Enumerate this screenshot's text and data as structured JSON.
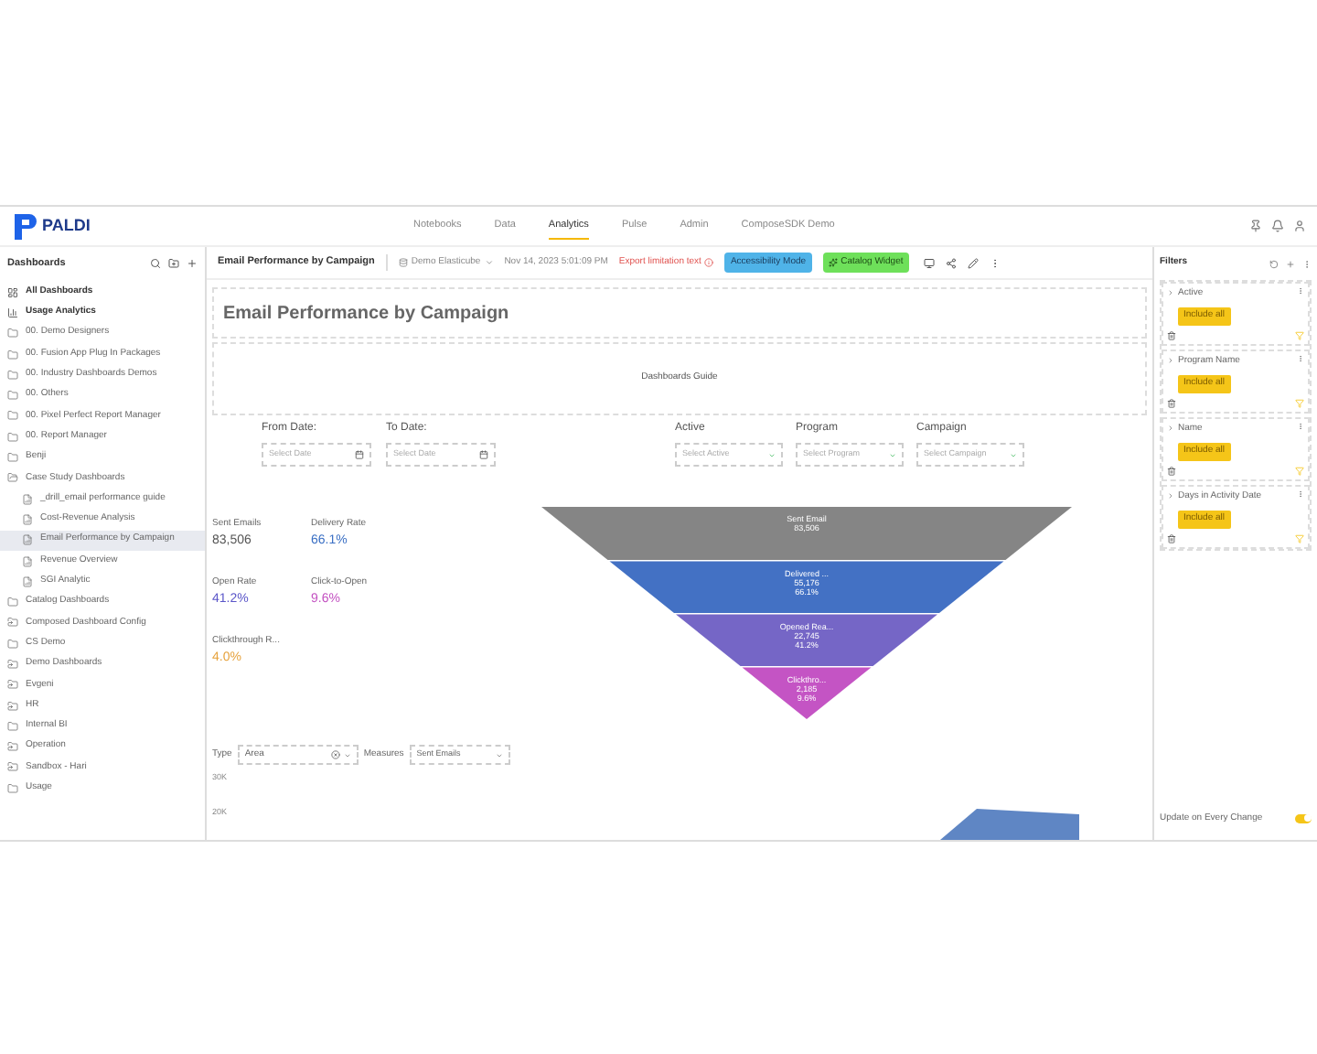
{
  "brand": "PALDI",
  "nav": [
    {
      "label": "Notebooks",
      "selected": false
    },
    {
      "label": "Data",
      "selected": false
    },
    {
      "label": "Analytics",
      "selected": true
    },
    {
      "label": "Pulse",
      "selected": false
    },
    {
      "label": "Admin",
      "selected": false
    },
    {
      "label": "ComposeSDK Demo",
      "selected": false
    }
  ],
  "sidebar": {
    "title": "Dashboards",
    "items": [
      {
        "kind": "all",
        "label": "All Dashboards",
        "selected": false
      },
      {
        "kind": "analytics",
        "label": "Usage Analytics",
        "selected": false
      },
      {
        "kind": "folder",
        "label": "00. Demo Designers",
        "selected": false
      },
      {
        "kind": "folder",
        "label": "00. Fusion App Plug In Packages",
        "selected": false
      },
      {
        "kind": "folder",
        "label": "00. Industry Dashboards Demos",
        "selected": false
      },
      {
        "kind": "folder",
        "label": "00. Others",
        "selected": false
      },
      {
        "kind": "folder",
        "label": "00. Pixel Perfect Report Manager",
        "selected": false
      },
      {
        "kind": "folder",
        "label": "00. Report Manager",
        "selected": false
      },
      {
        "kind": "folder",
        "label": "Benji",
        "selected": false
      },
      {
        "kind": "folder-open",
        "label": "Case Study Dashboards",
        "selected": false,
        "children": [
          {
            "kind": "dashboard",
            "label": "_drill_email performance guide",
            "selected": false
          },
          {
            "kind": "dashboard",
            "label": "Cost-Revenue Analysis",
            "selected": false
          },
          {
            "kind": "dashboard",
            "label": "Email Performance by Campaign",
            "selected": true
          },
          {
            "kind": "dashboard",
            "label": "Revenue Overview",
            "selected": false
          },
          {
            "kind": "dashboard",
            "label": "SGI Analytic",
            "selected": false
          }
        ]
      },
      {
        "kind": "folder",
        "label": "Catalog Dashboards",
        "selected": false
      },
      {
        "kind": "shared",
        "label": "Composed Dashboard Config",
        "selected": false
      },
      {
        "kind": "folder",
        "label": "CS Demo",
        "selected": false
      },
      {
        "kind": "shared",
        "label": "Demo Dashboards",
        "selected": false
      },
      {
        "kind": "shared",
        "label": "Evgeni",
        "selected": false
      },
      {
        "kind": "shared",
        "label": "HR",
        "selected": false
      },
      {
        "kind": "folder",
        "label": "Internal BI",
        "selected": false
      },
      {
        "kind": "shared",
        "label": "Operation",
        "selected": false
      },
      {
        "kind": "shared",
        "label": "Sandbox - Hari",
        "selected": false
      },
      {
        "kind": "folder",
        "label": "Usage",
        "selected": false
      }
    ]
  },
  "toolbar": {
    "title": "Email Performance by Campaign",
    "cube": "Demo Elasticube",
    "timestamp": "Nov 14, 2023 5:01:09 PM",
    "export_note": "Export limitation text",
    "accessibility_button": "Accessibility Mode",
    "catalog_button": "Catalog Widget"
  },
  "dashboard": {
    "title": "Email Performance by Campaign",
    "guide": "Dashboards Guide",
    "date_filters": [
      {
        "label": "From Date:",
        "placeholder": "Select Date"
      },
      {
        "label": "To Date:",
        "placeholder": "Select Date"
      }
    ],
    "select_filters": [
      {
        "label": "Active",
        "placeholder": "Select Active"
      },
      {
        "label": "Program",
        "placeholder": "Select Program"
      },
      {
        "label": "Campaign",
        "placeholder": "Select Campaign"
      }
    ],
    "kpis": [
      {
        "label": "Sent Emails",
        "value": "83,506",
        "color": "#555555"
      },
      {
        "label": "Delivery Rate",
        "value": "66.1%",
        "color": "#3a6fc4"
      },
      {
        "label": "Open Rate",
        "value": "41.2%",
        "color": "#5a55c8"
      },
      {
        "label": "Click-to-Open",
        "value": "9.6%",
        "color": "#c24fc0"
      },
      {
        "label": "Clickthrough R...",
        "value": "4.0%",
        "color": "#e6a23c"
      }
    ],
    "funnel": [
      {
        "lines": [
          "Sent Email",
          "83,506"
        ],
        "color": "#858585"
      },
      {
        "lines": [
          "Delivered ...",
          "55,176",
          "66.1%"
        ],
        "color": "#4371c4"
      },
      {
        "lines": [
          "Opened Rea...",
          "22,745",
          "41.2%"
        ],
        "color": "#7566c6"
      },
      {
        "lines": [
          "Clickthro...",
          "2,185",
          "9.6%"
        ],
        "color": "#c454c4"
      }
    ],
    "chart_controls": {
      "type_label": "Type",
      "type_value": "Area",
      "measures_label": "Measures",
      "measures_value": "Sent Emails"
    },
    "y_ticks": [
      "30K",
      "20K"
    ]
  },
  "filters": {
    "title": "Filters",
    "groups": [
      {
        "label": "Active",
        "button": "Include all"
      },
      {
        "label": "Program Name",
        "button": "Include all"
      },
      {
        "label": "Name",
        "button": "Include all"
      },
      {
        "label": "Days in Activity Date",
        "button": "Include all"
      }
    ],
    "update_label": "Update on Every Change",
    "update_on": true
  }
}
